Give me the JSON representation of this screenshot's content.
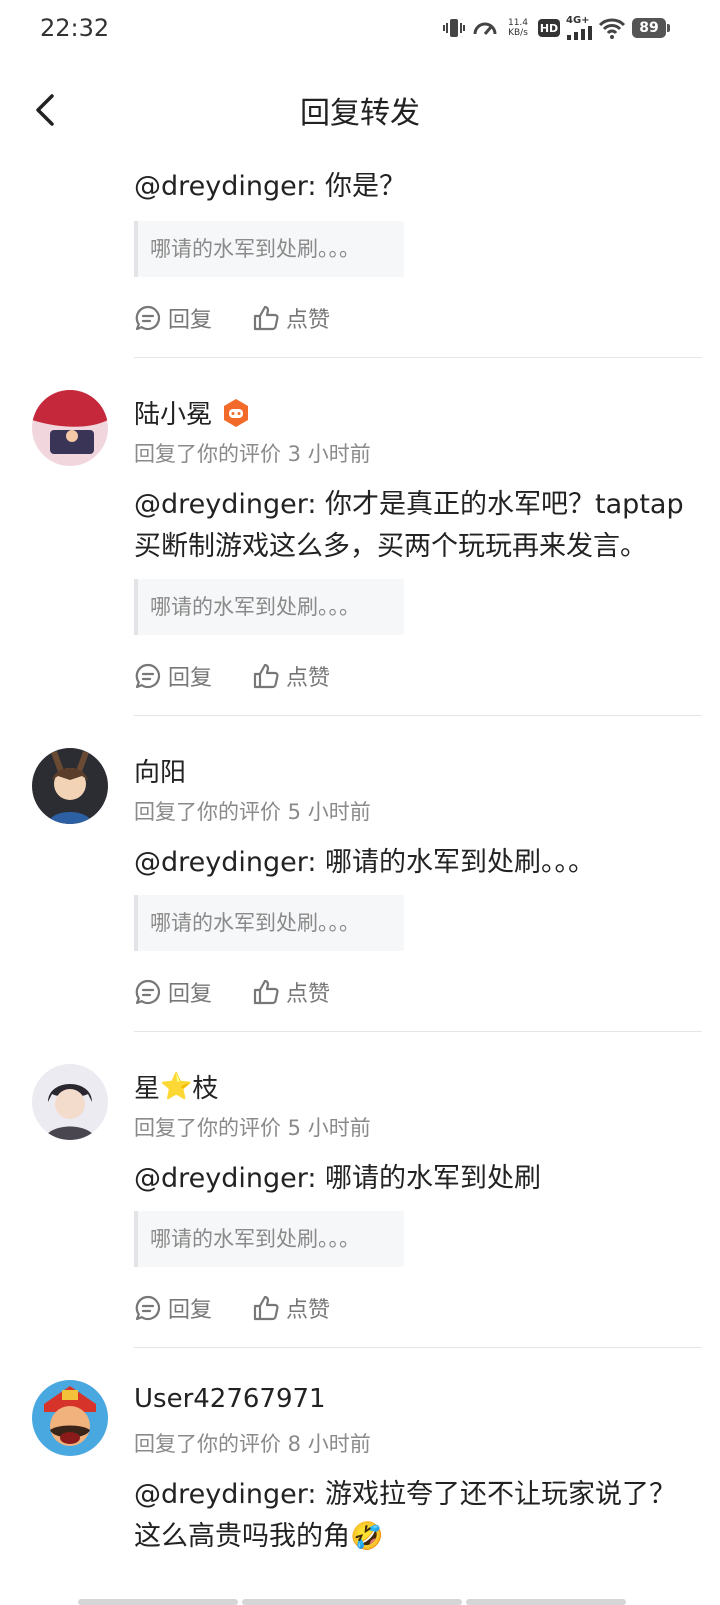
{
  "status_bar": {
    "time": "22:32",
    "net_speed_value": "11.4",
    "net_speed_unit": "KB/s",
    "hd": "HD",
    "network": "4G+",
    "battery": "89",
    "icons": [
      "vibrate-icon",
      "speedometer-icon",
      "signal-icon",
      "wifi-icon"
    ]
  },
  "header": {
    "title": "回复转发",
    "back_icon": "chevron-left-icon"
  },
  "actions": {
    "reply_label": "回复",
    "like_label": "点赞"
  },
  "items": [
    {
      "content": "@dreydinger: 你是？",
      "quote": "哪请的水军到处刷。。。"
    },
    {
      "username": "陆小冕",
      "meta": "回复了你的评价 3 小时前",
      "content": "@dreydinger: 你才是真正的水军吧？taptap买断制游戏这么多，买两个玩玩再来发言。",
      "quote": "哪请的水军到处刷。。。",
      "badge_icon": "game-controller-badge-icon"
    },
    {
      "username": "向阳",
      "meta": "回复了你的评价 5 小时前",
      "content": "@dreydinger: 哪请的水军到处刷。。。",
      "quote": "哪请的水军到处刷。。。"
    },
    {
      "username_part1": "星",
      "username_part2": "枝",
      "username_star": "⭐",
      "meta": "回复了你的评价 5 小时前",
      "content": "@dreydinger: 哪请的水军到处刷",
      "quote": "哪请的水军到处刷。。。"
    },
    {
      "username": "User42767971",
      "meta": "回复了你的评价 8 小时前",
      "content": "@dreydinger: 游戏拉夸了还不让玩家说了？这么高贵吗我的角🤣"
    }
  ]
}
